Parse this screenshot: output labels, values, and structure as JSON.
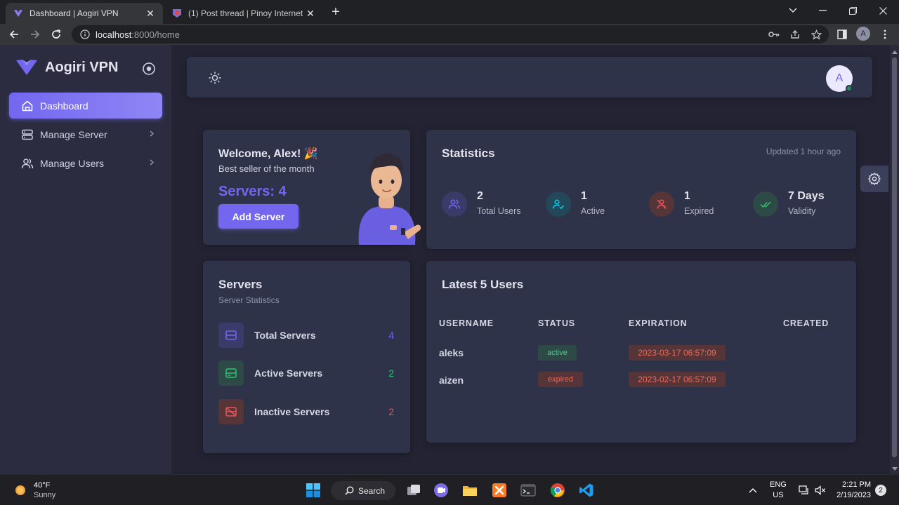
{
  "browser": {
    "tabs": [
      {
        "title": "Dashboard | Aogiri VPN",
        "active": true
      },
      {
        "title": "(1) Post thread | Pinoy Internet and",
        "active": false
      }
    ],
    "url_host": "localhost",
    "url_path": ":8000/home",
    "profile_initial": "A"
  },
  "sidebar": {
    "brand": "Aogiri VPN",
    "items": [
      {
        "label": "Dashboard",
        "icon": "home-icon",
        "active": true
      },
      {
        "label": "Manage Server",
        "icon": "server-icon",
        "active": false
      },
      {
        "label": "Manage Users",
        "icon": "users-icon",
        "active": false
      }
    ]
  },
  "topnav": {
    "avatar_initial": "A"
  },
  "welcome": {
    "title": "Welcome, Alex! 🎉",
    "subtitle": "Best seller of the month",
    "servers": "Servers: 4",
    "button": "Add Server"
  },
  "statistics": {
    "title": "Statistics",
    "updated": "Updated 1 hour ago",
    "items": [
      {
        "value": "2",
        "label": "Total Users",
        "color": "#7367f0"
      },
      {
        "value": "1",
        "label": "Active",
        "color": "#00cfe8"
      },
      {
        "value": "1",
        "label": "Expired",
        "color": "#ea5455"
      },
      {
        "value": "7 Days",
        "label": "Validity",
        "color": "#28c76f"
      }
    ]
  },
  "servers": {
    "title": "Servers",
    "subtitle": "Server Statistics",
    "rows": [
      {
        "label": "Total Servers",
        "value": "4",
        "color": "#7367f0"
      },
      {
        "label": "Active Servers",
        "value": "2",
        "color": "#28c76f"
      },
      {
        "label": "Inactive Servers",
        "value": "2",
        "color": "#ea5455"
      }
    ]
  },
  "latest_users": {
    "title": "Latest 5 Users",
    "columns": [
      "USERNAME",
      "STATUS",
      "EXPIRATION",
      "CREATED"
    ],
    "rows": [
      {
        "username": "aleks",
        "status": "active",
        "expiration": "2023-03-17 06:57:09",
        "created": ""
      },
      {
        "username": "aizen",
        "status": "expired",
        "expiration": "2023-02-17 06:57:09",
        "created": ""
      }
    ]
  },
  "taskbar": {
    "weather_temp": "40°F",
    "weather_cond": "Sunny",
    "search_label": "Search",
    "lang_1": "ENG",
    "lang_2": "US",
    "time": "2:21 PM",
    "date": "2/19/2023",
    "notifications": "2"
  }
}
